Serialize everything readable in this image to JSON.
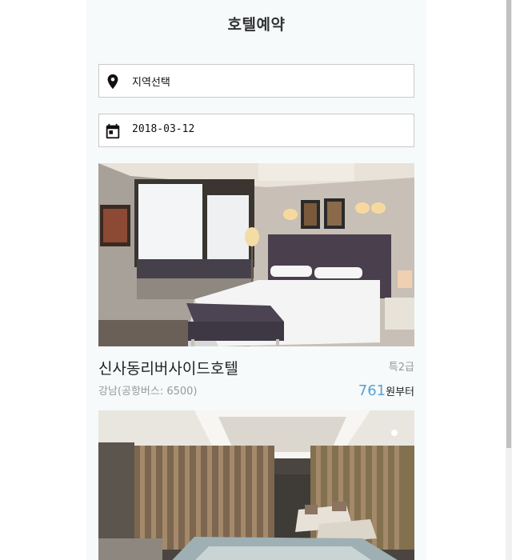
{
  "header": {
    "title": "호텔예약"
  },
  "search": {
    "region_label": "지역선택",
    "region_icon": "location-pin-icon",
    "date_value": "2018-03-12",
    "date_icon": "calendar-icon"
  },
  "hotels": [
    {
      "name": "신사동리버사이드호텔",
      "grade": "특2급",
      "location": "강남(공항버스: 6500)",
      "price": "761",
      "price_suffix": "원부터"
    },
    {}
  ],
  "colors": {
    "price_accent": "#5a9fd2",
    "panel_background": "#f6fafb"
  }
}
